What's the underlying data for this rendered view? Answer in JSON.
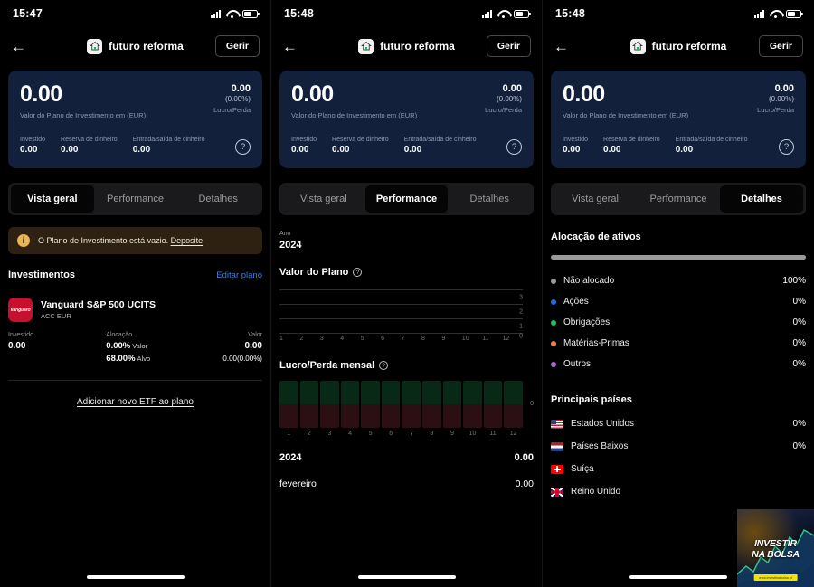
{
  "app": {
    "plan_title": "futuro reforma",
    "manage_label": "Gerir",
    "back_icon": "←",
    "plan_icon": "home-icon"
  },
  "status": {
    "time_1": "15:47",
    "time_2": "15:48",
    "time_3": "15:48",
    "signal_icon": "signal-bars-icon",
    "wifi_icon": "wifi-icon",
    "battery_icon": "battery-icon"
  },
  "summary_card": {
    "value": "0.00",
    "value_caption": "Valor do Plano de Investimento em (EUR)",
    "pl_value": "0.00",
    "pl_percent": "(0.00%)",
    "pl_label": "Lucro/Perda",
    "metrics": [
      {
        "label": "Investido",
        "value": "0.00"
      },
      {
        "label": "Reserva de dinheiro",
        "value": "0.00"
      },
      {
        "label": "Entrada/saída de cinheiro",
        "value": "0.00"
      }
    ],
    "help_label": "?"
  },
  "tabs": {
    "overview": "Vista geral",
    "performance": "Performance",
    "details": "Detalhes"
  },
  "overview": {
    "alert_icon": "info-icon",
    "alert_text": "O Plano de Investimento está vazio.",
    "alert_link": "Deposite",
    "section_title": "Investimentos",
    "edit_link": "Editar plano",
    "holding": {
      "logo_text": "Vanguard",
      "name": "Vanguard S&P 500 UCITS",
      "subtitle": "ACC EUR",
      "invested_label": "Investido",
      "invested_value": "0.00",
      "allocation_label": "Alocação",
      "allocation_current": "0.00%",
      "allocation_current_tag": "Valor",
      "allocation_target": "68.00%",
      "allocation_target_tag": "Alvo",
      "value_label": "Valor",
      "value_amount": "0.00",
      "value_change": "0.00(0.00%)"
    },
    "add_etf_link": "Adicionar novo ETF ao plano"
  },
  "performance": {
    "year_label": "Ano",
    "year_value": "2024",
    "plan_chart_title": "Valor do Plano",
    "monthly_chart_title": "Lucro/Perda mensal",
    "summary_rows": [
      {
        "key": "2024",
        "value": "0.00"
      },
      {
        "key": "fevereiro",
        "value": "0.00"
      }
    ]
  },
  "details": {
    "allocation_title": "Alocação de ativos",
    "allocation_items": [
      {
        "name": "Não alocado",
        "percent": "100%",
        "color": "#9a9a9d"
      },
      {
        "name": "Ações",
        "percent": "0%",
        "color": "#1f6fe0"
      },
      {
        "name": "Obrigações",
        "percent": "0%",
        "color": "#11c36a"
      },
      {
        "name": "Matérias-Primas",
        "percent": "0%",
        "color": "#ef7f4a"
      },
      {
        "name": "Outros",
        "percent": "0%",
        "color": "#b06ad4"
      }
    ],
    "countries_title": "Principais países",
    "countries": [
      {
        "name": "Estados Unidos",
        "percent": "0%",
        "flag": "flag-us"
      },
      {
        "name": "Países Baixos",
        "percent": "0%",
        "flag": "flag-nl"
      },
      {
        "name": "Suíça",
        "percent": "",
        "flag": "flag-ch"
      },
      {
        "name": "Reino Unido",
        "percent": "",
        "flag": "flag-gb"
      }
    ],
    "ad": {
      "line1": "INVESTIR",
      "line2": "NA BOLSA",
      "url": "www.investirnabolsa.pt"
    }
  },
  "chart_data": [
    {
      "type": "line",
      "title": "Valor do Plano",
      "x": [
        1,
        2,
        3,
        4,
        5,
        6,
        7,
        8,
        9,
        10,
        11,
        12
      ],
      "xlabel": "",
      "ylabel": "",
      "series": [
        {
          "name": "Valor do Plano",
          "values": [
            0,
            0,
            0,
            0,
            0,
            0,
            0,
            0,
            0,
            0,
            0,
            0
          ]
        }
      ],
      "yticks": [
        3,
        2,
        1,
        0
      ],
      "ylim": [
        0,
        3
      ],
      "grid": true,
      "legend": "none",
      "note": "Empty chart — no data plotted, only gridlines at 0,1,2,3"
    },
    {
      "type": "bar",
      "title": "Lucro/Perda mensal",
      "categories": [
        "1",
        "2",
        "3",
        "4",
        "5",
        "6",
        "7",
        "8",
        "9",
        "10",
        "11",
        "12"
      ],
      "values": [
        0,
        0,
        0,
        0,
        0,
        0,
        0,
        0,
        0,
        0,
        0,
        0
      ],
      "xlabel": "",
      "ylabel": "",
      "yticks": [
        0
      ],
      "grid": false,
      "legend": "none",
      "positive_color": "#072916",
      "negative_color": "#2c0f12",
      "note": "Placeholder columns split at zero line; no actual values"
    }
  ]
}
